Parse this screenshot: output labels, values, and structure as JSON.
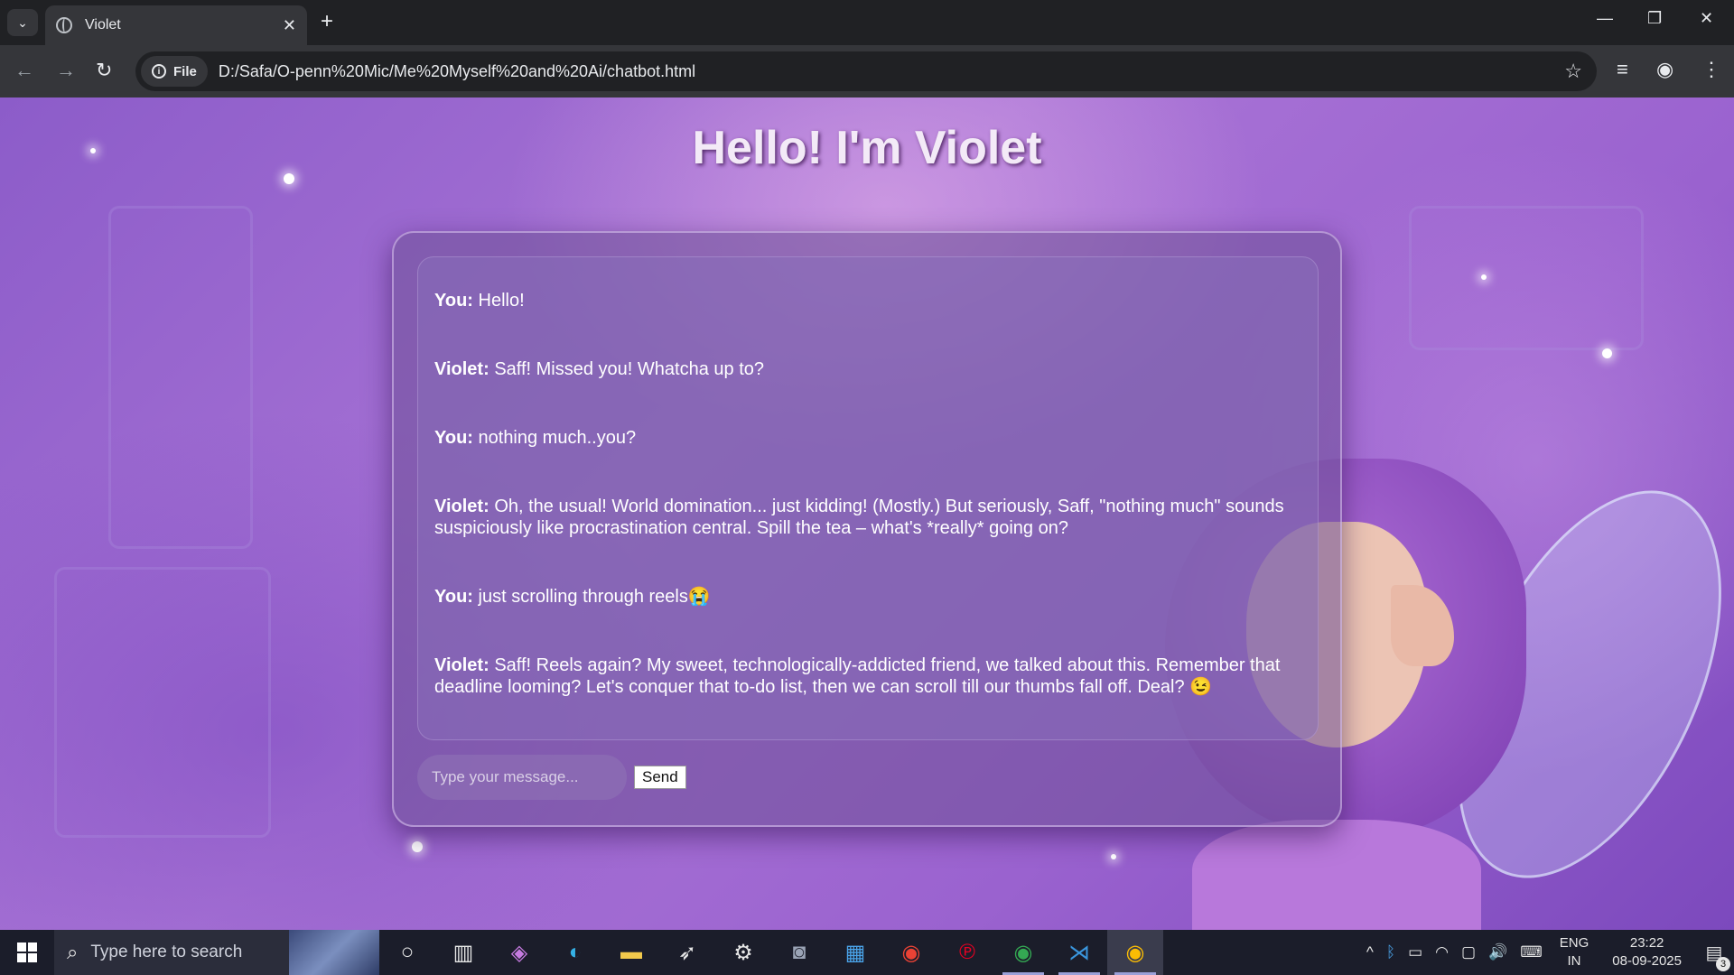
{
  "browser": {
    "tab_title": "Violet",
    "tab_close": "✕",
    "new_tab": "+",
    "file_chip": "File",
    "url": "D:/Safa/O-penn%20Mic/Me%20Myself%20and%20Ai/chatbot.html",
    "window_controls": {
      "minimize": "—",
      "maximize": "❐",
      "close": "✕"
    }
  },
  "page": {
    "title": "Hello! I'm Violet",
    "messages": [
      {
        "speaker": "You:",
        "text": " Hello!"
      },
      {
        "speaker": "Violet:",
        "text": " Saff! Missed you! Whatcha up to?"
      },
      {
        "speaker": "You:",
        "text": " nothing much..you?"
      },
      {
        "speaker": "Violet:",
        "text": " Oh, the usual! World domination... just kidding! (Mostly.) But seriously, Saff, \"nothing much\" sounds suspiciously like procrastination central. Spill the tea – what's *really* going on?"
      },
      {
        "speaker": "You:",
        "text": " just scrolling through reels😭"
      },
      {
        "speaker": "Violet:",
        "text": " Saff! Reels again? My sweet, technologically-addicted friend, we talked about this. Remember that deadline looming? Let's conquer that to-do list, then we can scroll till our thumbs fall off. Deal? 😉"
      }
    ],
    "input_placeholder": "Type your message...",
    "send_label": "Send"
  },
  "taskbar": {
    "search_placeholder": "Type here to search",
    "lang_top": "ENG",
    "lang_bottom": "IN",
    "time": "23:22",
    "date": "08-09-2025",
    "notification_count": "3"
  }
}
